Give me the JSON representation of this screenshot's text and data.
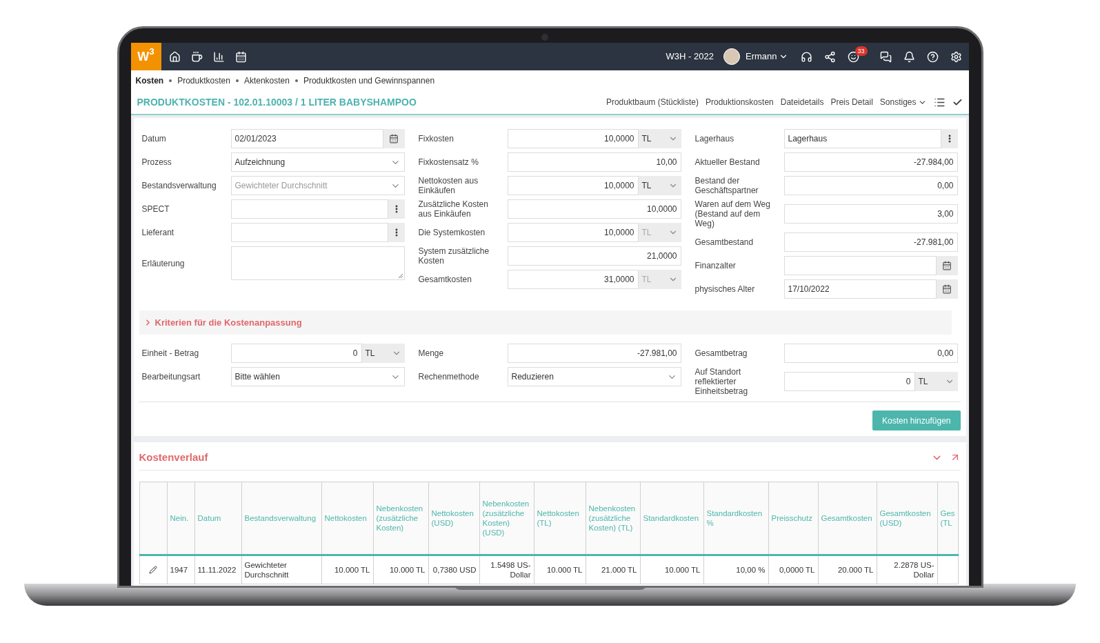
{
  "topbar": {
    "logo": "W$^{3}$",
    "company": "W3H - 2022",
    "user": "Ermann",
    "notification_count": "33"
  },
  "breadcrumbs": [
    {
      "label": "Kosten",
      "selected": true
    },
    {
      "label": "Produktkosten",
      "selected": false
    },
    {
      "label": "Aktenkosten",
      "selected": false
    },
    {
      "label": "Produktkosten und Gewinnspannen",
      "selected": false
    }
  ],
  "page_title": "PRODUKTKOSTEN - 102.01.10003 / 1 LITER BABYSHAMPOO",
  "header_links": [
    {
      "label": "Produktbaum (Stückliste)",
      "kind": "link"
    },
    {
      "label": "Produktionskosten",
      "kind": "link"
    },
    {
      "label": "Dateidetails",
      "kind": "link"
    },
    {
      "label": "Preis Detail",
      "kind": "link"
    },
    {
      "label": "Sonstiges",
      "kind": "dropdown"
    }
  ],
  "form_columns": [
    [
      {
        "label": "Datum",
        "kind": "date",
        "value": "02/01/2023"
      },
      {
        "label": "Prozess",
        "kind": "select",
        "value": "Aufzeichnung",
        "disabled": false
      },
      {
        "label": "Bestandsverwaltung",
        "kind": "select",
        "value": "Gewichteter Durchschnitt",
        "disabled": true
      },
      {
        "label": "SPECT",
        "kind": "lookup"
      },
      {
        "label": "Lieferant",
        "kind": "lookup"
      },
      {
        "label": "Erläuterung",
        "kind": "textarea"
      }
    ],
    [
      {
        "label": "Fixkosten",
        "kind": "number-unit",
        "value": "10,0000",
        "unit": "TL",
        "disabled": false
      },
      {
        "label": "Fixkostensatz %",
        "kind": "number",
        "value": "10,00"
      },
      {
        "label": "Nettokosten aus Einkäufen",
        "kind": "number-unit",
        "value": "10,0000",
        "unit": "TL",
        "disabled": false
      },
      {
        "label": "Zusätzliche Kosten aus Einkäufen",
        "kind": "number",
        "value": "10,0000"
      },
      {
        "label": "Die Systemkosten",
        "kind": "number-unit",
        "value": "10,0000",
        "unit": "TL",
        "disabled": true
      },
      {
        "label": "System zusätzliche Kosten",
        "kind": "number",
        "value": "21,0000"
      },
      {
        "label": "Gesamtkosten",
        "kind": "number-unit",
        "value": "31,0000",
        "unit": "TL",
        "disabled": true
      }
    ],
    [
      {
        "label": "Lagerhaus",
        "kind": "lookup",
        "value": "Lagerhaus"
      },
      {
        "label": "Aktueller Bestand",
        "kind": "number",
        "value": "-27.984,00"
      },
      {
        "label": "Bestand der Geschäftspartner",
        "kind": "number",
        "value": "0,00"
      },
      {
        "label": "Waren auf dem Weg (Bestand auf dem Weg)",
        "kind": "number",
        "value": "3,00"
      },
      {
        "label": "Gesamtbestand",
        "kind": "number",
        "value": "-27.981,00"
      },
      {
        "label": "Finanzalter",
        "kind": "date"
      },
      {
        "label": "physisches Alter",
        "kind": "date",
        "value": "17/10/2022"
      }
    ]
  ],
  "criteria": {
    "title": "Kriterien für die Kostenanpassung",
    "expanded": false
  },
  "adjust_columns": [
    [
      {
        "label": "Einheit - Betrag",
        "kind": "number-unit",
        "value": "0",
        "unit": "TL",
        "disabled": false
      },
      {
        "label": "Bearbeitungsart",
        "kind": "select",
        "value": "Bitte wählen",
        "disabled": false
      }
    ],
    [
      {
        "label": "Menge",
        "kind": "number",
        "value": "-27.981,00"
      },
      {
        "label": "Rechenmethode",
        "kind": "select",
        "value": "Reduzieren",
        "disabled": false
      }
    ],
    [
      {
        "label": "Gesamtbetrag",
        "kind": "number",
        "value": "0,00"
      },
      {
        "label": "Auf Standort reflektierter Einheitsbetrag",
        "kind": "number-unit",
        "value": "0",
        "unit": "TL",
        "disabled": false
      }
    ]
  ],
  "add_button": "Kosten hinzufügen",
  "history": {
    "title": "Kostenverlauf",
    "columns": [
      "Nein.",
      "Datum",
      "Bestandsverwaltung",
      "Nettokosten",
      "Nebenkosten (zusätzliche Kosten)",
      "Nettokosten (USD)",
      "Nebenkosten (zusätzliche Kosten) (USD)",
      "Nettokosten (TL)",
      "Nebenkosten (zusätzliche Kosten) (TL)",
      "Standardkosten",
      "Standardkosten %",
      "Preisschutz",
      "Gesamtkosten",
      "Gesamtkosten (USD)",
      "Ges (TL"
    ],
    "rows": [
      [
        "1947",
        "11.11.2022",
        "Gewichteter Durchschnitt",
        "10.000 TL",
        "10.000 TL",
        "0,7380 USD",
        "1.5498 US-Dollar",
        "10.000 TL",
        "21.000 TL",
        "10.000 TL",
        "10,00 %",
        "0,0000 TL",
        "20.000 TL",
        "2.2878 US-Dollar",
        null
      ]
    ]
  }
}
